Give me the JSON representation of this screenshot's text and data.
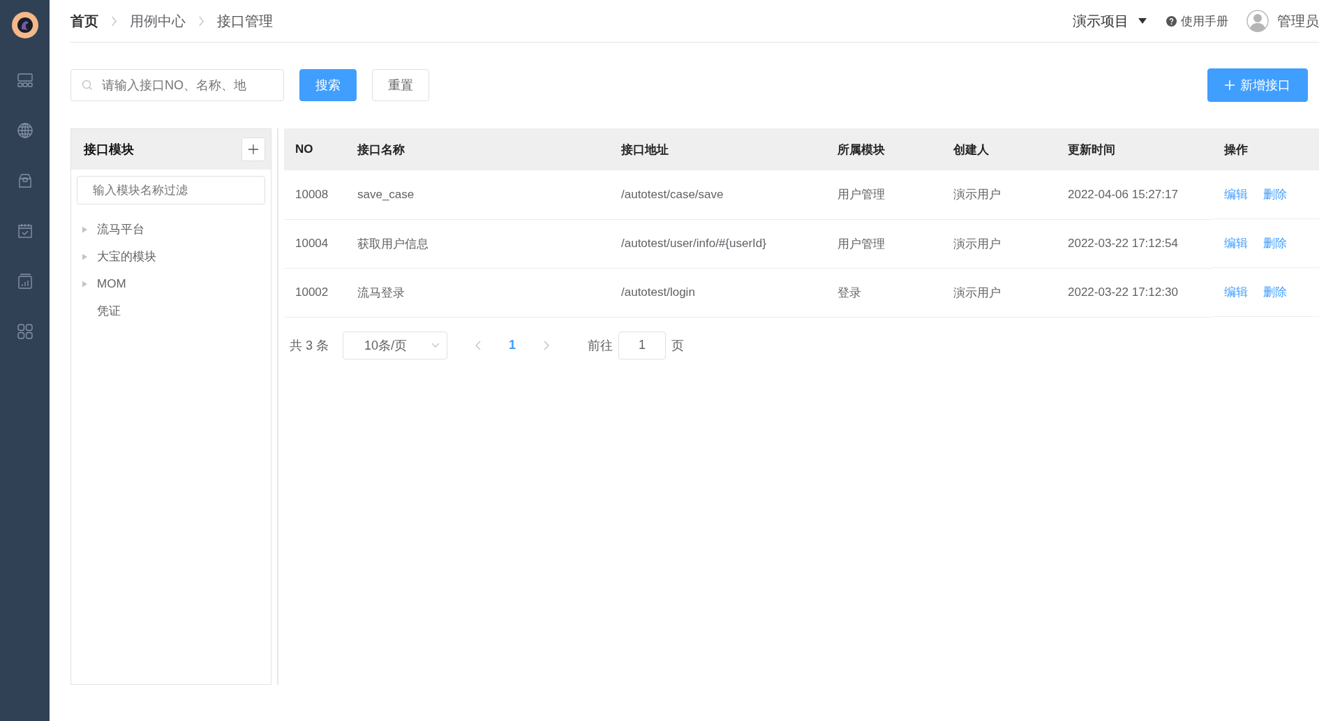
{
  "breadcrumb": [
    {
      "label": "首页",
      "current": false
    },
    {
      "label": "用例中心",
      "current": false
    },
    {
      "label": "接口管理",
      "current": true
    }
  ],
  "header": {
    "project": "演示项目",
    "help": "使用手册",
    "user": "管理员"
  },
  "sidebar": {
    "items": [
      {
        "selected": false
      },
      {
        "selected": false
      },
      {
        "selected": false
      },
      {
        "selected": false
      },
      {
        "selected": false
      },
      {
        "selected": false
      }
    ]
  },
  "toolbar": {
    "search": {
      "placeholder": "请输入接口NO、名称、地"
    },
    "search_button": "搜索",
    "reset_button": "重置",
    "add_button": "新增接口"
  },
  "modules": {
    "title": "接口模块",
    "filter": {
      "placeholder": "输入模块名称过滤"
    },
    "items": [
      {
        "label": "流马平台",
        "kind": "branch"
      },
      {
        "label": "大宝的模块",
        "kind": "branch"
      },
      {
        "label": "MOM",
        "kind": "branch"
      },
      {
        "label": "凭证",
        "kind": "leaf"
      }
    ]
  },
  "table": {
    "columns": [
      "NO",
      "接口名称",
      "接口地址",
      "所属模块",
      "创建人",
      "更新时间",
      "操作"
    ],
    "rows": [
      {
        "no": "10008",
        "name": "save_case",
        "path": "/autotest/case/save",
        "module": "用户管理",
        "creator": "演示用户",
        "updated": "2022-04-06 15:27:17",
        "actions": [
          "编辑",
          "删除"
        ]
      },
      {
        "no": "10004",
        "name": "获取用户信息",
        "path": "/autotest/user/info/#{userId}",
        "module": "用户管理",
        "creator": "演示用户",
        "updated": "2022-03-22 17:12:54",
        "actions": [
          "编辑",
          "删除"
        ]
      },
      {
        "no": "10002",
        "name": "流马登录",
        "path": "/autotest/login",
        "module": "登录",
        "creator": "演示用户",
        "updated": "2022-03-22 17:12:30",
        "actions": [
          "编辑",
          "删除"
        ]
      }
    ]
  },
  "pagination": {
    "total": "共 3 条",
    "page_size": "10条/页",
    "pages": [
      {
        "label": "1",
        "selected": true
      }
    ],
    "goto_label": "前往",
    "goto_value": "1",
    "goto_suffix": "页"
  }
}
